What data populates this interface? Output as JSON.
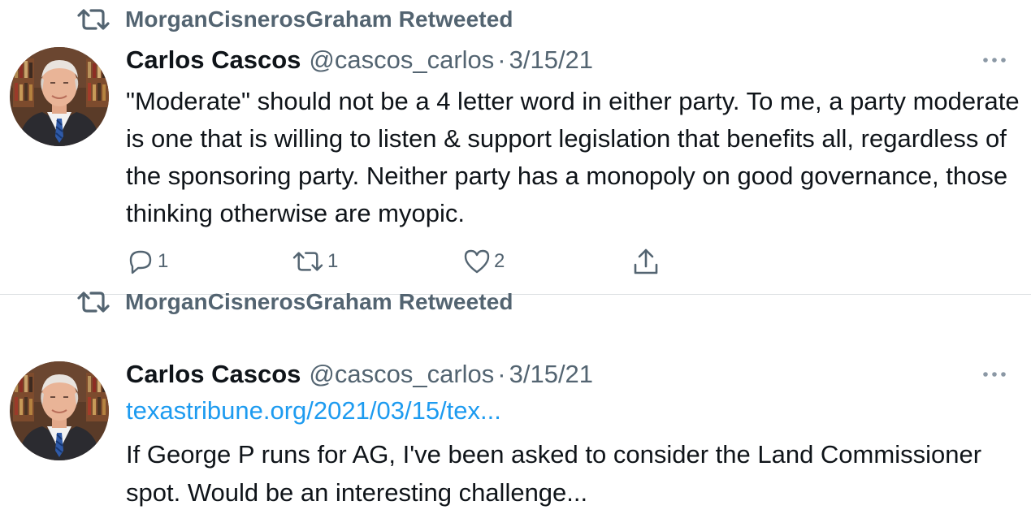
{
  "tweets": [
    {
      "retweeted_by": "MorganCisnerosGraham Retweeted",
      "author_name": "Carlos Cascos",
      "author_handle": "@cascos_carlos",
      "separator": "·",
      "date": "3/15/21",
      "text": "\"Moderate\" should not be a 4 letter word in either party. To me, a party moderate is one that is willing to listen & support legislation that benefits all, regardless of the sponsoring party. Neither party has a monopoly on good governance, those thinking otherwise are myopic.",
      "reply_count": "1",
      "retweet_count": "1",
      "like_count": "2"
    },
    {
      "retweeted_by": "MorganCisnerosGraham Retweeted",
      "author_name": "Carlos Cascos",
      "author_handle": "@cascos_carlos",
      "separator": "·",
      "date": "3/15/21",
      "link": "texastribune.org/2021/03/15/tex...",
      "text": "If George P runs for AG, I've been asked to consider the Land Commissioner spot. Would be an interesting challenge..."
    }
  ],
  "icons": {
    "retweet": "retweet-icon",
    "more": "more-icon",
    "reply": "reply-icon",
    "like": "heart-icon",
    "share": "share-icon"
  },
  "colors": {
    "secondary_text": "#536471",
    "primary_text": "#0f1419",
    "link": "#1d9bf0",
    "divider": "#dcdfe2"
  }
}
